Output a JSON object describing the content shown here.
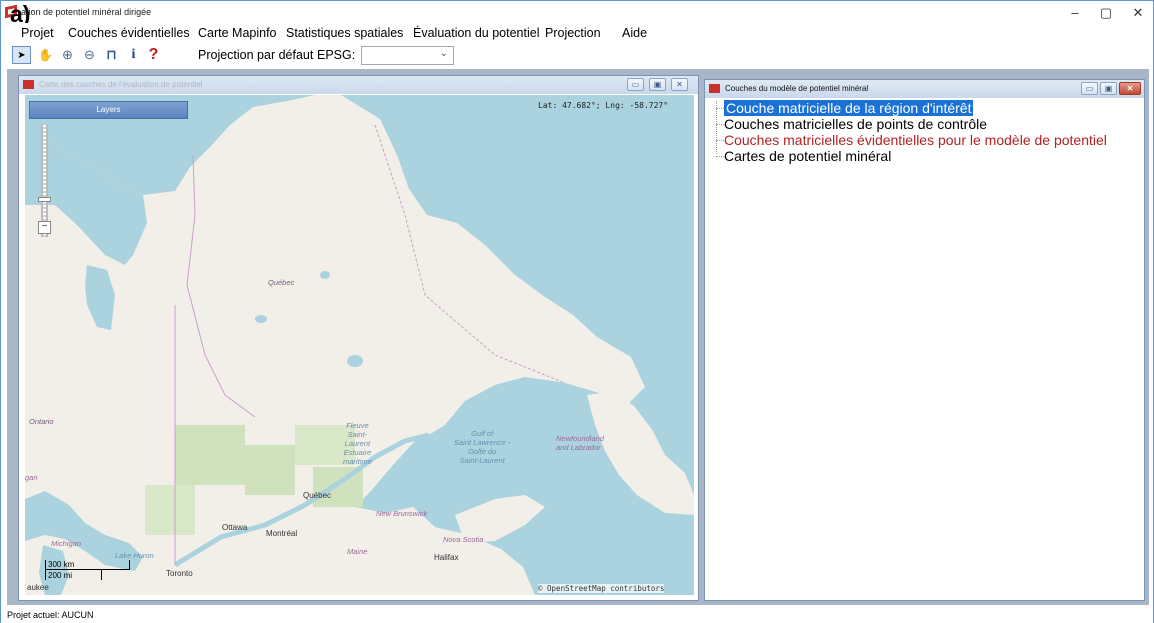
{
  "figure_label": "a)",
  "window": {
    "title": "ation de potentiel minéral dirigée",
    "controls": {
      "minimize": "–",
      "maximize": "▢",
      "close": "✕"
    }
  },
  "menu": {
    "items": [
      "Projet",
      "Couches évidentielles",
      "Carte Mapinfo",
      "Statistiques spatiales",
      "Évaluation du potentiel",
      "Projection",
      "Aide"
    ]
  },
  "toolbar": {
    "tools": [
      {
        "icon": "pointer-icon",
        "glyph": "➤"
      },
      {
        "icon": "pan-hand-icon",
        "glyph": "✋"
      },
      {
        "icon": "zoom-in-icon",
        "glyph": "⊕"
      },
      {
        "icon": "zoom-out-icon",
        "glyph": "⊖"
      },
      {
        "icon": "table-icon",
        "glyph": "⊓"
      },
      {
        "icon": "info-icon",
        "glyph": "i"
      },
      {
        "icon": "help-icon",
        "glyph": "?"
      }
    ],
    "projection_label": "Projection par défaut",
    "epsg_label": "EPSG:",
    "epsg_value": ""
  },
  "map_window": {
    "title": "Carte des couches de l'évaluation de potentiel",
    "layers_button": "Layers",
    "coords": "Lat: 47.682°; Lng: -58.727°",
    "attribution": "© OpenStreetMap contributors",
    "scale": {
      "km": "300 km",
      "mi": "200 mi"
    },
    "labels": {
      "quebec_region": "Québec",
      "ontario": "Ontario",
      "quebec_city": "Québec",
      "ottawa": "Ottawa",
      "montreal": "Montréal",
      "toronto": "Toronto",
      "halifax": "Halifax",
      "new_brunswick": "New Brunswick",
      "nova_scotia": "Nova Scotia",
      "maine": "Maine",
      "michigan": "Michigan",
      "lake_huron": "Lake Huron",
      "milwaukee": "aukee",
      "newfoundland": "Newfoundland\nand Labrador",
      "gulf": "Gulf of\nSaint Lawrence -\nGolfe du\nSaint-Laurent",
      "fleuve": "Fleuve\nSaint-\nLaurent\nEstuaire\nmaritime",
      "gb_fragment": "gan"
    }
  },
  "layer_window": {
    "title": "Couches du modèle de potentiel minéral",
    "items": [
      "Couche matricielle de la région d'intérêt",
      "Couches matricielles de points de contrôle",
      "Couches matricielles évidentielles pour le modèle de potentiel",
      "Cartes de potentiel minéral"
    ],
    "selected_index": 0,
    "colors": {
      "selected_bg": "#1a72d6",
      "evidential": "#b22222"
    }
  },
  "status": {
    "text": "Projet actuel: AUCUN"
  }
}
